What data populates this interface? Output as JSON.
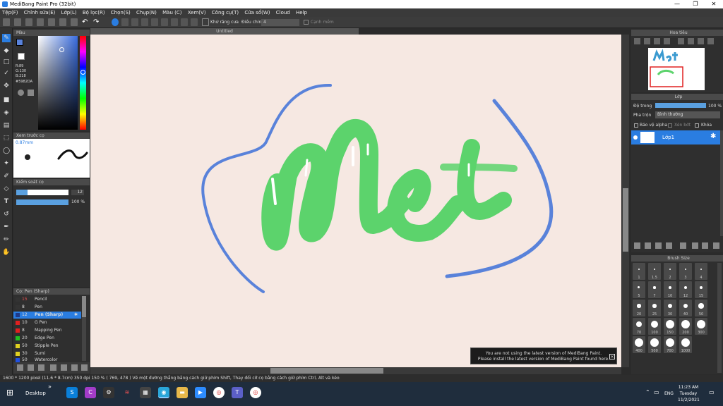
{
  "window": {
    "title": "MediBang Paint Pro (32bit)",
    "minimize": "—",
    "restore": "❐",
    "close": "✕"
  },
  "menu": [
    "Tệp(F)",
    "Chỉnh sửa(E)",
    "Lớp(L)",
    "Bộ lọc(R)",
    "Chọn(S)",
    "Chụp(N)",
    "Màu (C)",
    "Xem(V)",
    "Công cụ(T)",
    "Cửa sổ(W)",
    "Cloud",
    "Help"
  ],
  "toolbar": {
    "antialias_label": "Khử răng cưa",
    "adjust_label": "Điều chỉnh",
    "adjust_value": "4",
    "smooth_label": "Cạnh mềm"
  },
  "color_panel": {
    "title": "Màu",
    "r": "R:89",
    "g": "G:130",
    "b": "B:218",
    "hex": "#5982DA"
  },
  "preview_panel": {
    "title": "Xem trước cọ",
    "size": "0.87mm"
  },
  "brush_control": {
    "title": "Kiểm soát cọ",
    "size": "12",
    "opacity": "100 %"
  },
  "brush_list": {
    "title": "Cọ: Pen (Sharp)",
    "items": [
      {
        "n": "15",
        "label": "Pencil",
        "color": "#333333"
      },
      {
        "n": "8",
        "label": "Pen",
        "color": "#333333"
      },
      {
        "n": "12",
        "label": "Pen (Sharp)",
        "color": "#1e3a8a"
      },
      {
        "n": "10",
        "label": "G Pen",
        "color": "#e02020"
      },
      {
        "n": "8",
        "label": "Mapping Pen",
        "color": "#e02020"
      },
      {
        "n": "20",
        "label": "Edge Pen",
        "color": "#20c020"
      },
      {
        "n": "50",
        "label": "Stipple Pen",
        "color": "#e0d020"
      },
      {
        "n": "30",
        "label": "Sumi",
        "color": "#e0d020"
      },
      {
        "n": "50",
        "label": "Watercolor",
        "color": "#2050e0"
      }
    ]
  },
  "canvas": {
    "tab": "Untitled"
  },
  "navigator": {
    "title": "Hoa tiêu"
  },
  "layer_panel": {
    "title": "Lớp",
    "opacity_label": "Độ trong",
    "opacity_value": "100 %",
    "blend_label": "Pha trộn",
    "blend_value": "Bình thường",
    "protect_alpha": "Bảo vệ alpha",
    "clip": "Xén bớt",
    "lock": "Khóa",
    "layer_name": "Lớp1"
  },
  "brush_size": {
    "title": "Brush Size",
    "sizes": [
      "1",
      "1.5",
      "2",
      "3",
      "4",
      "5",
      "7",
      "10",
      "12",
      "15",
      "20",
      "25",
      "30",
      "40",
      "50",
      "70",
      "100",
      "150",
      "200",
      "300",
      "400",
      "500",
      "700",
      "1000"
    ]
  },
  "notification": {
    "line1": "You are not using the latest version of MediBang Paint.",
    "line2": "Please install the latest version of MediBang Paint found here."
  },
  "status": {
    "text": "1600 * 1200 pixel   (11.6 * 8.7cm)   350 dpi   150 %   ( 769, 478 )   Vẽ một đường thẳng bằng cách giữ phím Shift, Thay đổi cỡ cọ bằng cách giữ phím Ctrl, Alt và kéo"
  },
  "taskbar": {
    "desktop": "Desktop",
    "lang": "ENG",
    "time": "11:23 AM",
    "day": "Tuesday",
    "date": "11/2/2021"
  }
}
